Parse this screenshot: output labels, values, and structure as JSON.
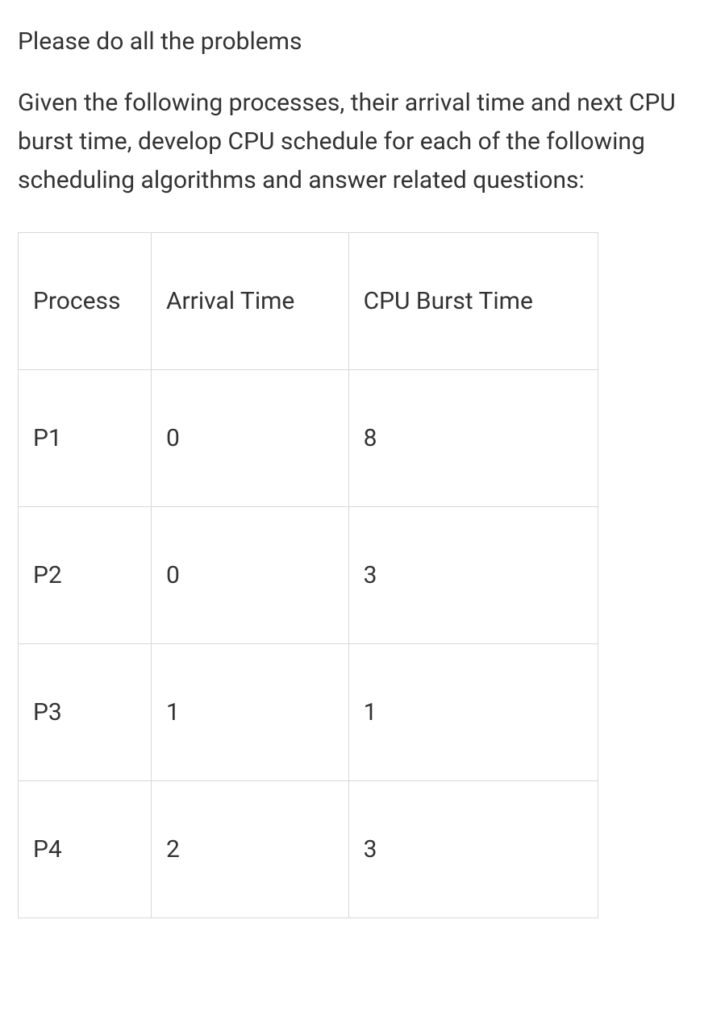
{
  "intro": "Please do all the problems",
  "description": "Given the following processes, their arrival time and next CPU burst time, develop CPU schedule for each of the following scheduling algorithms and answer related questions:",
  "chart_data": {
    "type": "table",
    "headers": [
      "Process",
      "Arrival Time",
      "CPU Burst Time"
    ],
    "rows": [
      {
        "process": "P1",
        "arrival": "0",
        "burst": "8"
      },
      {
        "process": "P2",
        "arrival": "0",
        "burst": "3"
      },
      {
        "process": "P3",
        "arrival": "1",
        "burst": "1"
      },
      {
        "process": "P4",
        "arrival": "2",
        "burst": "3"
      }
    ]
  }
}
